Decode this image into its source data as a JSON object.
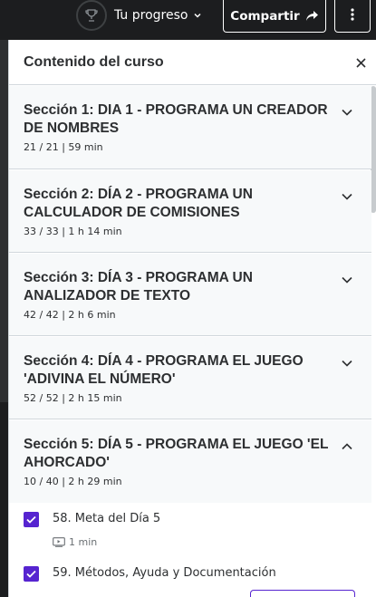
{
  "topbar": {
    "progress_label": "Tu progreso",
    "share_label": "Compartir"
  },
  "drawer": {
    "title": "Contenido del curso"
  },
  "sections": [
    {
      "title": "Sección 1: DIA 1 - PROGRAMA UN CREADOR DE NOMBRES",
      "meta": "21 / 21 | 59 min",
      "expanded": false
    },
    {
      "title": "Sección 2: DÍA 2 - PROGRAMA UN CALCULADOR DE COMISIONES",
      "meta": "33 / 33 | 1 h 14 min",
      "expanded": false
    },
    {
      "title": "Sección 3: DÍA 3 - PROGRAMA UN ANALIZADOR DE TEXTO",
      "meta": "42 / 42 | 2 h 6 min",
      "expanded": false
    },
    {
      "title": "Sección 4: DÍA 4 - PROGRAMA EL JUEGO 'ADIVINA EL NÚMERO'",
      "meta": "52 / 52 | 2 h 15 min",
      "expanded": false
    },
    {
      "title": "Sección 5: DÍA 5 - PROGRAMA EL JUEGO 'EL AHORCADO'",
      "meta": "10 / 40 | 2 h 29 min",
      "expanded": true
    }
  ],
  "lectures": [
    {
      "title": "58. Meta del Día 5",
      "duration": "1 min",
      "completed": true
    },
    {
      "title": "59. Métodos, Ayuda y Documentación",
      "duration": "",
      "completed": true
    }
  ],
  "colors": {
    "accent": "#5624d0",
    "section_bg": "#f7f9fa",
    "dark_bg": "#1c1d1f",
    "border": "#d1d7dc"
  },
  "icons": {
    "trophy": "trophy-icon",
    "chevron": "chevron-down-icon",
    "share": "share-arrow-icon",
    "more": "vertical-dots-icon",
    "close": "close-icon",
    "check": "checkmark-icon",
    "video": "video-icon"
  }
}
